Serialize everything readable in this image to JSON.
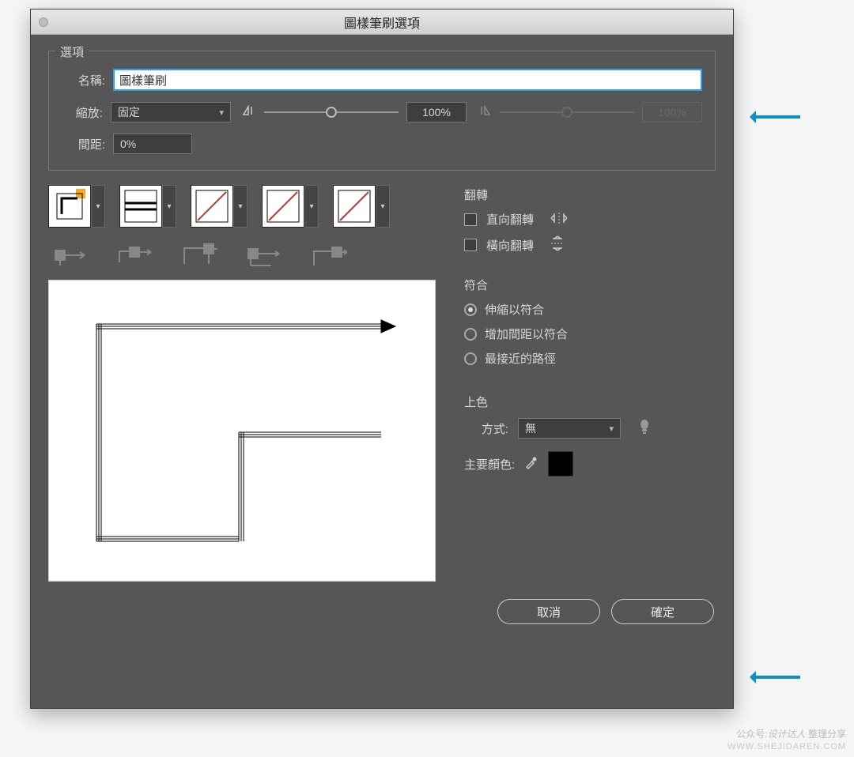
{
  "dialog": {
    "title": "圖樣筆刷選項"
  },
  "options": {
    "legend": "選項",
    "name_label": "名稱:",
    "name_value": "圖樣筆刷",
    "scale_label": "縮放:",
    "scale_mode": "固定",
    "scale_value": "100%",
    "scale_value_disabled": "100%",
    "spacing_label": "間距:",
    "spacing_value": "0%"
  },
  "flip": {
    "title": "翻轉",
    "flip_along_label": "直向翻轉",
    "flip_across_label": "橫向翻轉"
  },
  "fit": {
    "title": "符合",
    "stretch_label": "伸縮以符合",
    "space_label": "增加間距以符合",
    "approx_label": "最接近的路徑",
    "selected": "stretch"
  },
  "colorize": {
    "title": "上色",
    "method_label": "方式:",
    "method_value": "無",
    "key_color_label": "主要顏色:"
  },
  "buttons": {
    "cancel": "取消",
    "ok": "確定"
  },
  "watermark": {
    "line1_prefix": "公众号:",
    "line1_brand": "设计达人",
    "line1_suffix": " 整理分享",
    "line2": "WWW.SHEJIDAREN.COM"
  }
}
